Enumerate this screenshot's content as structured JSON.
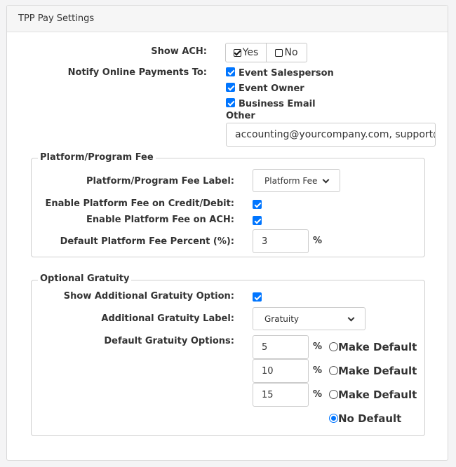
{
  "panel": {
    "title": "TPP Pay Settings"
  },
  "show_ach": {
    "label": "Show ACH:",
    "yes_label": "Yes",
    "no_label": "No",
    "selected": "Yes"
  },
  "notify": {
    "label": "Notify Online Payments To:",
    "options": [
      {
        "label": "Event Salesperson",
        "checked": true
      },
      {
        "label": "Event Owner",
        "checked": true
      },
      {
        "label": "Business Email",
        "checked": true
      }
    ],
    "other_label": "Other",
    "other_value": "accounting@yourcompany.com, support@yourcompany.com"
  },
  "platform_fee": {
    "legend": "Platform/Program Fee",
    "label_field": {
      "label": "Platform/Program Fee Label:",
      "value": "Platform Fee"
    },
    "enable_credit": {
      "label": "Enable Platform Fee on Credit/Debit:",
      "checked": true
    },
    "enable_ach": {
      "label": "Enable Platform Fee on ACH:",
      "checked": true
    },
    "percent": {
      "label": "Default Platform Fee Percent (%):",
      "value": "3",
      "unit": "%"
    }
  },
  "gratuity": {
    "legend": "Optional Gratuity",
    "show_option": {
      "label": "Show Additional Gratuity Option:",
      "checked": true
    },
    "label_field": {
      "label": "Additional Gratuity Label:",
      "value": "Gratuity"
    },
    "defaults": {
      "label": "Default Gratuity Options:",
      "unit": "%",
      "options": [
        {
          "value": "5",
          "radio_label": "Make Default",
          "selected": false
        },
        {
          "value": "10",
          "radio_label": "Make Default",
          "selected": false
        },
        {
          "value": "15",
          "radio_label": "Make Default",
          "selected": false
        }
      ],
      "no_default_label": "No Default",
      "no_default_selected": true
    }
  },
  "colors": {
    "accent": "#0075ff",
    "border": "#cfcfcf",
    "header_bg": "#f6f6f6"
  }
}
